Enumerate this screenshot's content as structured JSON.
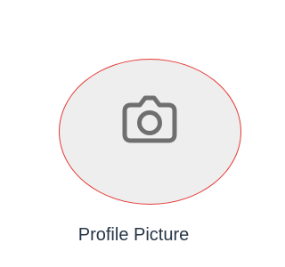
{
  "profile_picture": {
    "label": "Profile Picture",
    "icon": "camera-icon",
    "colors": {
      "circle_fill": "#eeeeee",
      "circle_border": "#e53935",
      "icon_stroke": "#6f6f6f",
      "label_text": "#263545"
    }
  }
}
